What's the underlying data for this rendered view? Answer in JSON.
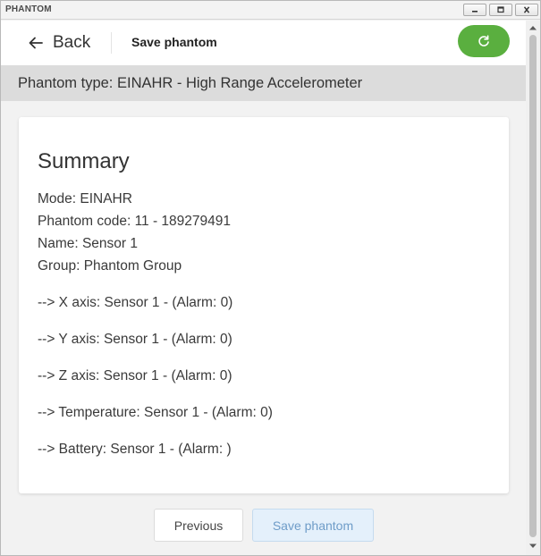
{
  "window": {
    "title": "PHANTOM"
  },
  "header": {
    "back_label": "Back",
    "title": "Save phantom"
  },
  "phantom_type": "Phantom type: EINAHR - High Range Accelerometer",
  "summary": {
    "title": "Summary",
    "mode": "Mode: EINAHR",
    "phantom_code": "Phantom code: 11 - 189279491",
    "name": "Name: Sensor 1",
    "group": "Group: Phantom Group",
    "axes": [
      "--> X axis: Sensor 1 - (Alarm: 0)",
      "--> Y axis: Sensor 1 - (Alarm: 0)",
      "--> Z axis: Sensor 1 - (Alarm: 0)",
      "--> Temperature: Sensor 1 - (Alarm: 0)",
      "--> Battery: Sensor 1 - (Alarm: )"
    ]
  },
  "buttons": {
    "previous": "Previous",
    "save": "Save phantom"
  },
  "colors": {
    "accent_green": "#5aaf3f",
    "save_button_bg": "#e4f0fb",
    "type_bar_bg": "#dcdcdc"
  },
  "icons": {
    "back": "arrow-left-icon",
    "refresh": "refresh-icon",
    "minimize": "minimize-icon",
    "maximize": "maximize-icon",
    "close": "close-icon"
  }
}
